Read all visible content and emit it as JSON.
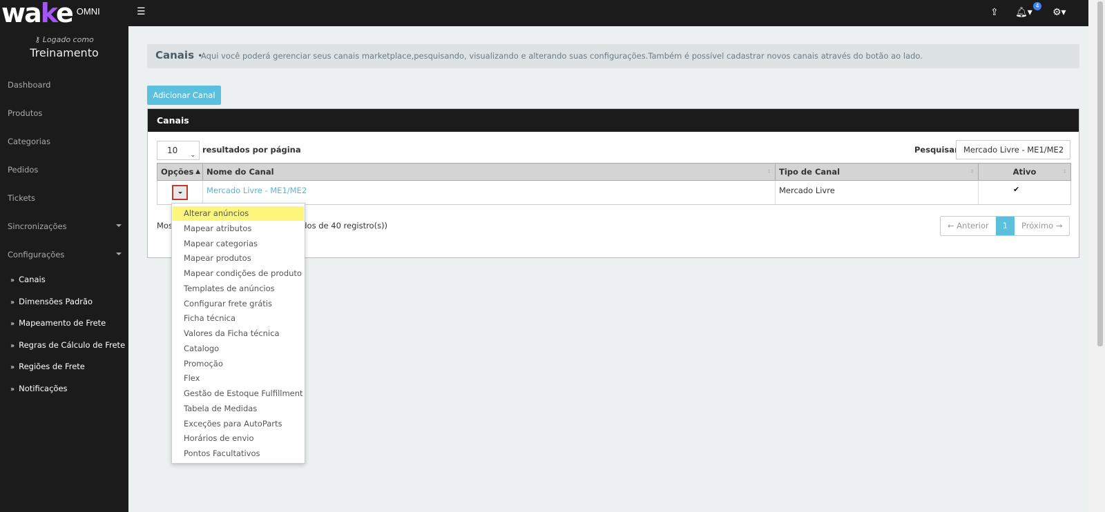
{
  "brand": {
    "logo_main": "wa",
    "logo_accent": "k",
    "logo_end": "e",
    "product": "OMNI"
  },
  "header": {
    "menu_icon": "hamburger-icon",
    "notification_count": "4",
    "icons": [
      "share-icon",
      "bell-icon",
      "gear-icon"
    ]
  },
  "sidebar": {
    "logged_label": "Logado como",
    "user": "Treinamento",
    "items": [
      {
        "label": "Dashboard"
      },
      {
        "label": "Produtos"
      },
      {
        "label": "Categorias"
      },
      {
        "label": "Pedidos"
      },
      {
        "label": "Tickets"
      },
      {
        "label": "Sincronizações"
      },
      {
        "label": "Configurações"
      }
    ],
    "sub_items": [
      {
        "label": "Canais"
      },
      {
        "label": "Dimensões Padrão"
      },
      {
        "label": "Mapeamento de Frete"
      },
      {
        "label": "Regras de Cálculo de Frete"
      },
      {
        "label": "Regiões de Frete"
      },
      {
        "label": "Notificações"
      }
    ]
  },
  "page": {
    "title": "Canais",
    "bullet": "•",
    "description": "Aqui você poderá gerenciar seus canais marketplace,pesquisando, visualizando e alterando suas configurações.Também é possível cadastrar novos canais através do botão ao lado.",
    "add_button": "Adicionar Canal"
  },
  "panel": {
    "title": "Canais",
    "per_page_value": "10",
    "per_page_label": "resultados por página",
    "search_label": "Pesquisar",
    "search_value": "Mercado Livre - ME1/ME2",
    "columns": [
      "Opções",
      "Nome do Canal",
      "Tipo de Canal",
      "Ativo"
    ],
    "rows": [
      {
        "name": "Mercado Livre - ME1/ME2",
        "type": "Mercado Livre",
        "active": "✔"
      }
    ],
    "showing_prefix": "Mos",
    "showing_suffix": "trados de 40 registro(s))",
    "pager": {
      "prev": "← Anterior",
      "current": "1",
      "next": "Próximo →"
    }
  },
  "dropdown": {
    "items": [
      "Alterar anúncios",
      "Mapear atributos",
      "Mapear categorias",
      "Mapear produtos",
      "Mapear condições de produto",
      "Templates de anúncios",
      "Configurar frete grátis",
      "Ficha técnica",
      "Valores da Ficha técnica",
      "Catalogo",
      "Promoção",
      "Flex",
      "Gestão de Estoque Fulfillment",
      "Tabela de Medidas",
      "Exceções para AutoParts",
      "Horários de envio",
      "Pontos Facultativos"
    ],
    "highlighted_color": "#fcf77c"
  }
}
